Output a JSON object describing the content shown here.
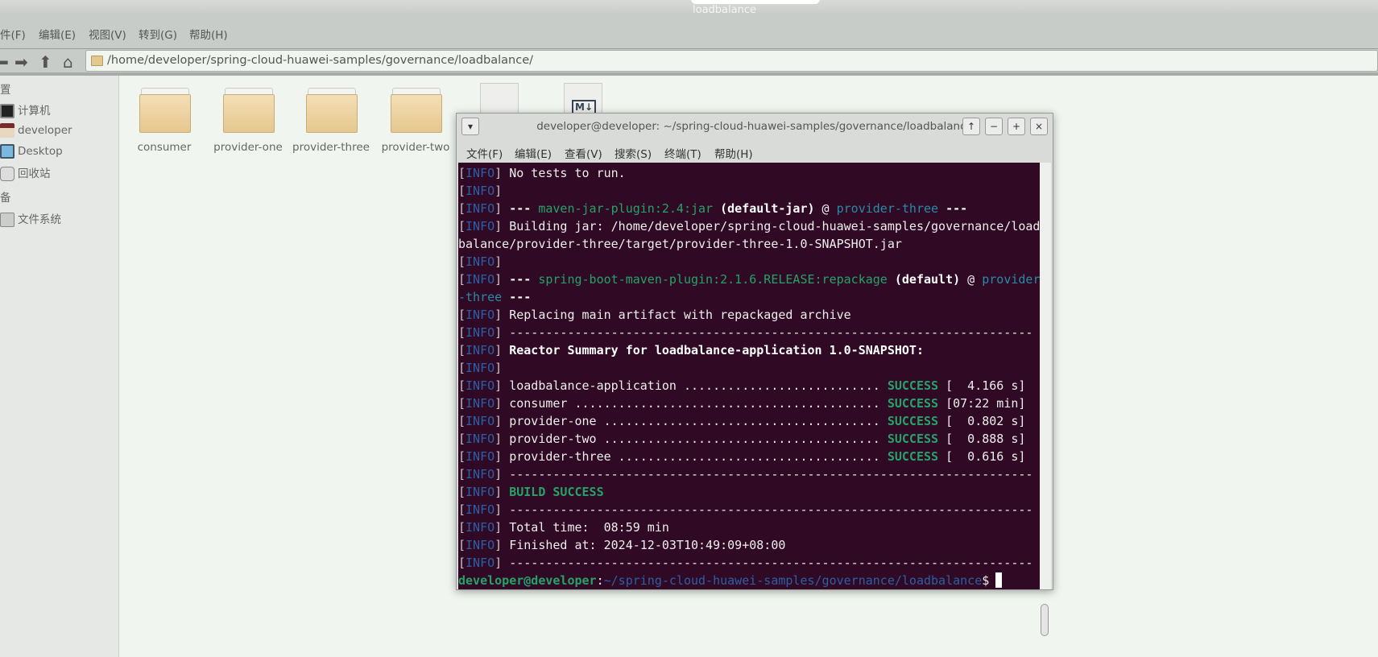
{
  "window": {
    "title": "loadbalance"
  },
  "fm_menu": [
    "件(F)",
    "编辑(E)",
    "视图(V)",
    "转到(G)",
    "帮助(H)"
  ],
  "address": "/home/developer/spring-cloud-huawei-samples/governance/loadbalance/",
  "sidebar": {
    "places_header": "置",
    "items": [
      "计算机",
      "developer",
      "Desktop",
      "回收站"
    ],
    "devices_header": "备",
    "devices": [
      "文件系统"
    ]
  },
  "files": [
    "consumer",
    "provider-one",
    "provider-three",
    "provider-two"
  ],
  "terminal": {
    "title": "developer@developer: ~/spring-cloud-huawei-samples/governance/loadbalance",
    "menu": [
      "文件(F)",
      "编辑(E)",
      "查看(V)",
      "搜索(S)",
      "终端(T)",
      "帮助(H)"
    ],
    "buttons": [
      "↑",
      "−",
      "+",
      "×"
    ],
    "lines": [
      [
        [
          "b",
          "["
        ],
        [
          "i",
          "INFO"
        ],
        [
          "b",
          "]"
        ],
        [
          "t",
          " No tests to run."
        ]
      ],
      [
        [
          "b",
          "["
        ],
        [
          "i",
          "INFO"
        ],
        [
          "b",
          "]"
        ]
      ],
      [
        [
          "b",
          "["
        ],
        [
          "i",
          "INFO"
        ],
        [
          "b",
          "]"
        ],
        [
          "w",
          " ---"
        ],
        [
          "g",
          " maven-jar-plugin:2.4:jar"
        ],
        [
          "w",
          " (default-jar)"
        ],
        [
          "t",
          " @ "
        ],
        [
          "c",
          "provider-three"
        ],
        [
          "w",
          " ---"
        ]
      ],
      [
        [
          "b",
          "["
        ],
        [
          "i",
          "INFO"
        ],
        [
          "b",
          "]"
        ],
        [
          "t",
          " Building jar: /home/developer/spring-cloud-huawei-samples/governance/load"
        ]
      ],
      [
        [
          "t",
          "balance/provider-three/target/provider-three-1.0-SNAPSHOT.jar"
        ]
      ],
      [
        [
          "b",
          "["
        ],
        [
          "i",
          "INFO"
        ],
        [
          "b",
          "]"
        ]
      ],
      [
        [
          "b",
          "["
        ],
        [
          "i",
          "INFO"
        ],
        [
          "b",
          "]"
        ],
        [
          "w",
          " ---"
        ],
        [
          "g",
          " spring-boot-maven-plugin:2.1.6.RELEASE:repackage"
        ],
        [
          "w",
          " (default)"
        ],
        [
          "t",
          " @ "
        ],
        [
          "c",
          "provider"
        ]
      ],
      [
        [
          "c",
          "-three"
        ],
        [
          "w",
          " ---"
        ]
      ],
      [
        [
          "b",
          "["
        ],
        [
          "i",
          "INFO"
        ],
        [
          "b",
          "]"
        ],
        [
          "t",
          " Replacing main artifact with repackaged archive"
        ]
      ],
      [
        [
          "b",
          "["
        ],
        [
          "i",
          "INFO"
        ],
        [
          "b",
          "]"
        ],
        [
          "t",
          " ------------------------------------------------------------------------"
        ]
      ],
      [
        [
          "b",
          "["
        ],
        [
          "i",
          "INFO"
        ],
        [
          "b",
          "]"
        ],
        [
          "w",
          " Reactor Summary for loadbalance-application 1.0-SNAPSHOT:"
        ]
      ],
      [
        [
          "b",
          "["
        ],
        [
          "i",
          "INFO"
        ],
        [
          "b",
          "]"
        ]
      ],
      [
        [
          "b",
          "["
        ],
        [
          "i",
          "INFO"
        ],
        [
          "b",
          "]"
        ],
        [
          "t",
          " loadbalance-application ........................... "
        ],
        [
          "gb",
          "SUCCESS"
        ],
        [
          "t",
          " [  4.166 s]"
        ]
      ],
      [
        [
          "b",
          "["
        ],
        [
          "i",
          "INFO"
        ],
        [
          "b",
          "]"
        ],
        [
          "t",
          " consumer .......................................... "
        ],
        [
          "gb",
          "SUCCESS"
        ],
        [
          "t",
          " [07:22 min]"
        ]
      ],
      [
        [
          "b",
          "["
        ],
        [
          "i",
          "INFO"
        ],
        [
          "b",
          "]"
        ],
        [
          "t",
          " provider-one ...................................... "
        ],
        [
          "gb",
          "SUCCESS"
        ],
        [
          "t",
          " [  0.802 s]"
        ]
      ],
      [
        [
          "b",
          "["
        ],
        [
          "i",
          "INFO"
        ],
        [
          "b",
          "]"
        ],
        [
          "t",
          " provider-two ...................................... "
        ],
        [
          "gb",
          "SUCCESS"
        ],
        [
          "t",
          " [  0.888 s]"
        ]
      ],
      [
        [
          "b",
          "["
        ],
        [
          "i",
          "INFO"
        ],
        [
          "b",
          "]"
        ],
        [
          "t",
          " provider-three .................................... "
        ],
        [
          "gb",
          "SUCCESS"
        ],
        [
          "t",
          " [  0.616 s]"
        ]
      ],
      [
        [
          "b",
          "["
        ],
        [
          "i",
          "INFO"
        ],
        [
          "b",
          "]"
        ],
        [
          "t",
          " ------------------------------------------------------------------------"
        ]
      ],
      [
        [
          "b",
          "["
        ],
        [
          "i",
          "INFO"
        ],
        [
          "b",
          "]"
        ],
        [
          "gb",
          " BUILD SUCCESS"
        ]
      ],
      [
        [
          "b",
          "["
        ],
        [
          "i",
          "INFO"
        ],
        [
          "b",
          "]"
        ],
        [
          "t",
          " ------------------------------------------------------------------------"
        ]
      ],
      [
        [
          "b",
          "["
        ],
        [
          "i",
          "INFO"
        ],
        [
          "b",
          "]"
        ],
        [
          "t",
          " Total time:  08:59 min"
        ]
      ],
      [
        [
          "b",
          "["
        ],
        [
          "i",
          "INFO"
        ],
        [
          "b",
          "]"
        ],
        [
          "t",
          " Finished at: 2024-12-03T10:49:09+08:00"
        ]
      ],
      [
        [
          "b",
          "["
        ],
        [
          "i",
          "INFO"
        ],
        [
          "b",
          "]"
        ],
        [
          "t",
          " ------------------------------------------------------------------------"
        ]
      ],
      [
        [
          "gb",
          "developer@developer"
        ],
        [
          "t",
          ":"
        ],
        [
          "p",
          "~/spring-cloud-huawei-samples/governance/loadbalance"
        ],
        [
          "t",
          "$"
        ]
      ]
    ]
  }
}
